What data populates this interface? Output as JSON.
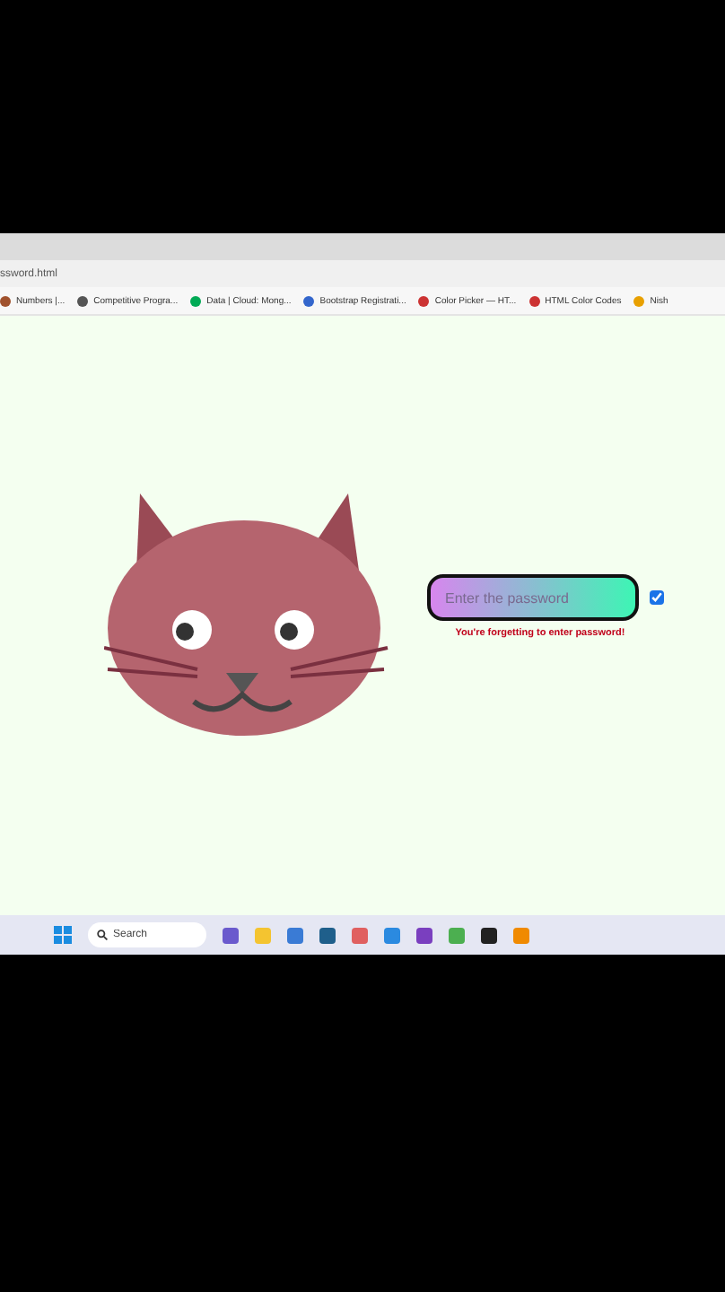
{
  "address_bar": {
    "url": "ssword.html"
  },
  "bookmarks": [
    {
      "label": "Numbers |..."
    },
    {
      "label": "Competitive Progra..."
    },
    {
      "label": "Data | Cloud: Mong..."
    },
    {
      "label": "Bootstrap Registrati..."
    },
    {
      "label": "Color Picker — HT..."
    },
    {
      "label": "HTML Color Codes"
    },
    {
      "label": "Nish"
    }
  ],
  "password": {
    "placeholder": "Enter the password",
    "show_password": true,
    "error": "You're forgetting to enter password!"
  },
  "taskbar": {
    "search": {
      "placeholder": "Search"
    }
  }
}
